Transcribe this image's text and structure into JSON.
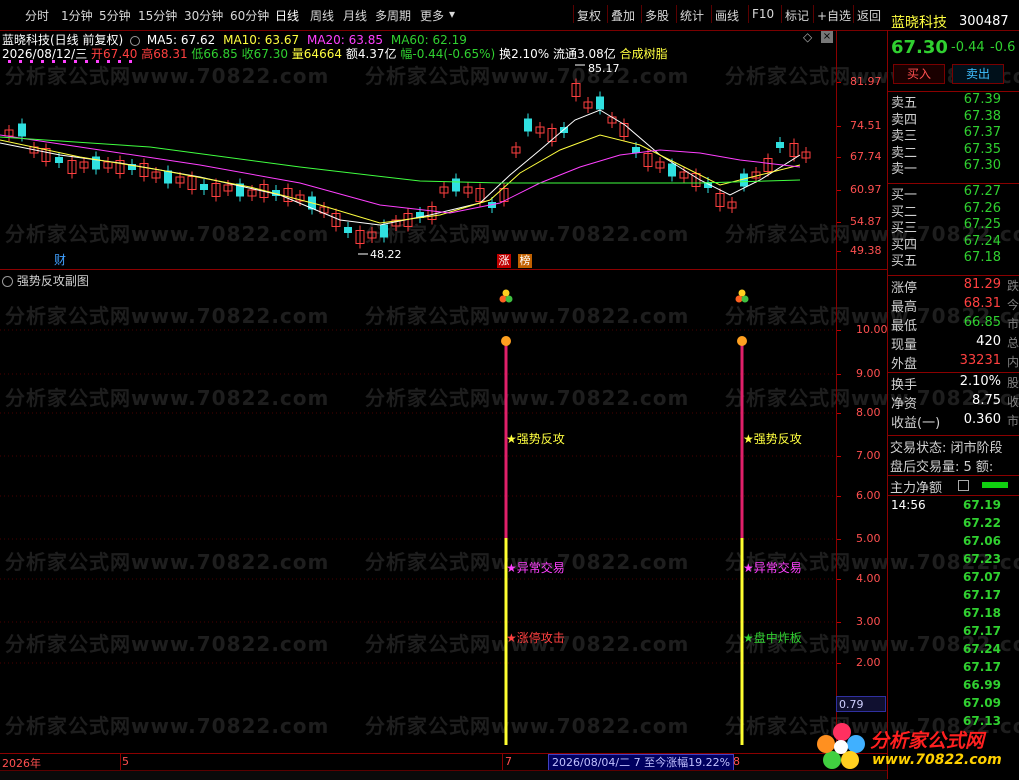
{
  "toolbar": {
    "periods": [
      "分时",
      "1分钟",
      "5分钟",
      "15分钟",
      "30分钟",
      "60分钟",
      "日线",
      "周线",
      "月线",
      "多周期",
      "更多"
    ],
    "active_period": "日线",
    "more_arrow": "▾",
    "actions": [
      "复权",
      "叠加",
      "多股",
      "统计",
      "画线",
      "F10",
      "标记",
      "+自选",
      "返回"
    ]
  },
  "chart_header": {
    "title": "蓝晓科技(日线 前复权)",
    "ma5": "MA5: 67.62",
    "ma10": "MA10: 63.67",
    "ma20": "MA20: 63.85",
    "ma60": "MA60: 62.19",
    "info_date": "2026/08/12/三",
    "info_open": "开67.40",
    "info_high": "高68.31",
    "info_low": "低66.85",
    "info_close": "收67.30",
    "info_vol": "量64664",
    "info_amt": "额4.37亿",
    "info_chg": "幅-0.44(-0.65%)",
    "info_turn": "换2.10%",
    "info_float": "流通3.08亿",
    "info_concept": "合成树脂"
  },
  "price_axis": [
    "81.97",
    "74.51",
    "67.74",
    "60.97",
    "54.87",
    "49.38"
  ],
  "price_marks": {
    "high": "85.17",
    "low": "48.22"
  },
  "badges": {
    "cai": "财",
    "zhang": "涨",
    "bang": "榜"
  },
  "sub_chart": {
    "title": "强势反攻副图",
    "axis": [
      "10.00",
      "9.00",
      "8.00",
      "7.00",
      "6.00",
      "5.00",
      "4.00",
      "3.00",
      "2.00"
    ],
    "current_value": "0.79",
    "signals_left": [
      "★强势反攻",
      "★异常交易",
      "★涨停攻击"
    ],
    "signals_right": [
      "★强势反攻",
      "★异常交易",
      "★盘中炸板"
    ]
  },
  "time_axis": {
    "year": "2026年",
    "m5": "5",
    "m7": "7",
    "m8": "8",
    "tooltip": "2026/08/04/二 7 至今涨幅19.22%"
  },
  "quote": {
    "name": "蓝晓科技",
    "code": "300487",
    "price": "67.30",
    "change": "-0.44",
    "pct": "-0.6",
    "buy_btn": "买入",
    "sell_btn": "卖出",
    "asks": [
      {
        "label": "卖五",
        "price": "67.39"
      },
      {
        "label": "卖四",
        "price": "67.38"
      },
      {
        "label": "卖三",
        "price": "67.37"
      },
      {
        "label": "卖二",
        "price": "67.35"
      },
      {
        "label": "卖一",
        "price": "67.30"
      }
    ],
    "bids": [
      {
        "label": "买一",
        "price": "67.27"
      },
      {
        "label": "买二",
        "price": "67.26"
      },
      {
        "label": "买三",
        "price": "67.25"
      },
      {
        "label": "买四",
        "price": "67.24"
      },
      {
        "label": "买五",
        "price": "67.18"
      }
    ],
    "stats": [
      {
        "label": "涨停",
        "value": "81.29",
        "color": "#ff4040",
        "x": "跌"
      },
      {
        "label": "最高",
        "value": "68.31",
        "color": "#ff4040",
        "x": "今"
      },
      {
        "label": "最低",
        "value": "66.85",
        "color": "#30d030",
        "x": "市"
      },
      {
        "label": "现量",
        "value": "420",
        "color": "#ffffff",
        "x": "总"
      },
      {
        "label": "外盘",
        "value": "33231",
        "color": "#ff4040",
        "x": "内"
      },
      {
        "label": "换手",
        "value": "2.10%",
        "color": "#ffffff",
        "x": "股"
      },
      {
        "label": "净资",
        "value": "8.75",
        "color": "#ffffff",
        "x": "收"
      },
      {
        "label": "收益(一)",
        "value": "0.360",
        "color": "#ffffff",
        "x": "市"
      }
    ],
    "trade_status": "交易状态: 闭市阶段",
    "after_vol": "盘后交易量: 5  额:",
    "main_net": "主力净额",
    "ticks_time": "14:56",
    "ticks": [
      "67.19",
      "67.22",
      "67.06",
      "67.23",
      "67.07",
      "67.17",
      "67.18",
      "67.17",
      "67.24",
      "67.17",
      "66.99",
      "67.09",
      "67.13"
    ]
  },
  "watermark": "分析家公式网www.70822.com",
  "logo": {
    "text": "分析家公式网",
    "url": "www.70822.com"
  },
  "colors": {
    "up": "#ff4040",
    "down": "#30e0e0",
    "ma5": "#ffffff",
    "ma10": "#ffff40",
    "ma20": "#ff40ff",
    "ma60": "#40ff40"
  }
}
